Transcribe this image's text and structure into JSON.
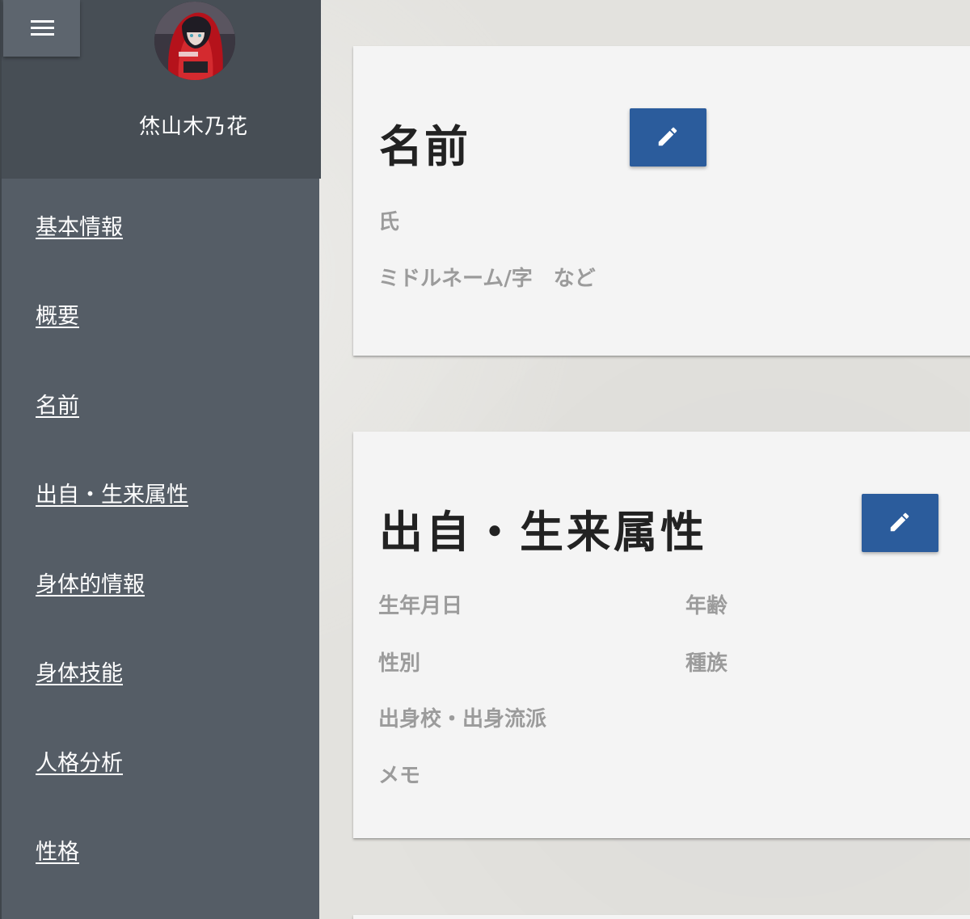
{
  "sidebar": {
    "menu_icon": "hamburger-menu-icon",
    "user_name": "烋山木乃花",
    "items": [
      {
        "label": "基本情報"
      },
      {
        "label": "概要"
      },
      {
        "label": "名前"
      },
      {
        "label": "出自・生来属性"
      },
      {
        "label": "身体的情報"
      },
      {
        "label": "身体技能"
      },
      {
        "label": "人格分析"
      },
      {
        "label": "性格"
      }
    ]
  },
  "cards": [
    {
      "title": "名前",
      "edit_icon": "pencil-icon",
      "fields": [
        "氏",
        "ミドルネーム/字　など"
      ]
    },
    {
      "title": "出自・生来属性",
      "edit_icon": "pencil-icon",
      "fields": [
        "生年月日",
        "年齢",
        "性別",
        "種族",
        "出身校・出身流派",
        "メモ"
      ]
    }
  ],
  "colors": {
    "sidebar": "#555d66",
    "sidebar_header": "#474e55",
    "edit_button": "#2b5c9c",
    "card": "#f4f4f4",
    "label": "#9b9b9b"
  }
}
